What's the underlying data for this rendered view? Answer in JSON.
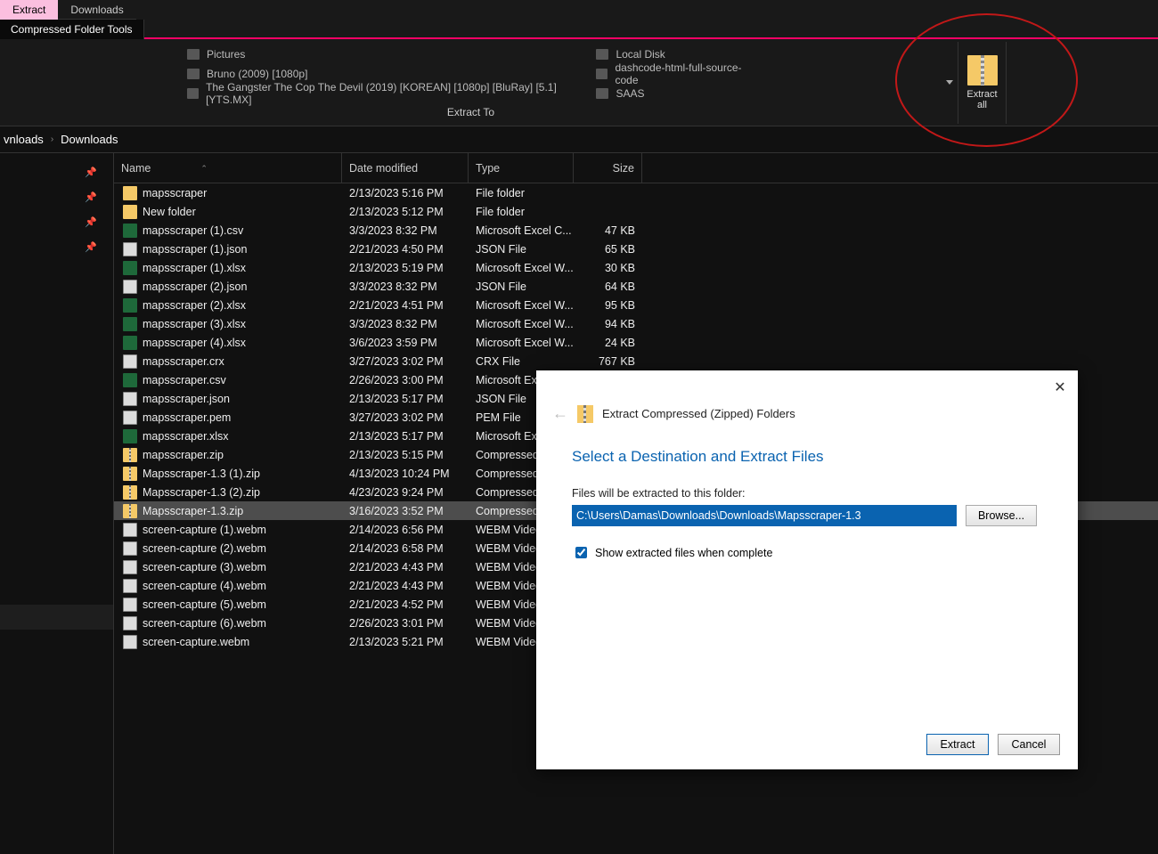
{
  "tabs": {
    "extract": "Extract",
    "downloads": "Downloads"
  },
  "toolbar": {
    "compressed": "Compressed Folder Tools"
  },
  "ribbon": {
    "left": [
      "Pictures",
      "Bruno (2009) [1080p]",
      "The Gangster The Cop The Devil (2019) [KOREAN] [1080p] [BluRay] [5.1] [YTS.MX]"
    ],
    "right": [
      "Local Disk",
      "dashcode-html-full-source-code",
      "SAAS"
    ],
    "extract_to": "Extract To",
    "extract_all1": "Extract",
    "extract_all2": "all"
  },
  "crumbs": {
    "a": "vnloads",
    "b": "Downloads"
  },
  "columns": {
    "name": "Name",
    "date": "Date modified",
    "type": "Type",
    "size": "Size"
  },
  "files": [
    {
      "icon": "ic-folder",
      "name": "mapsscraper",
      "date": "2/13/2023 5:16 PM",
      "type": "File folder",
      "size": ""
    },
    {
      "icon": "ic-folder",
      "name": "New folder",
      "date": "2/13/2023 5:12 PM",
      "type": "File folder",
      "size": ""
    },
    {
      "icon": "ic-csv",
      "name": "mapsscraper (1).csv",
      "date": "3/3/2023 8:32 PM",
      "type": "Microsoft Excel C...",
      "size": "47 KB"
    },
    {
      "icon": "ic-json",
      "name": "mapsscraper (1).json",
      "date": "2/21/2023 4:50 PM",
      "type": "JSON File",
      "size": "65 KB"
    },
    {
      "icon": "ic-xlsx",
      "name": "mapsscraper (1).xlsx",
      "date": "2/13/2023 5:19 PM",
      "type": "Microsoft Excel W...",
      "size": "30 KB"
    },
    {
      "icon": "ic-json",
      "name": "mapsscraper (2).json",
      "date": "3/3/2023 8:32 PM",
      "type": "JSON File",
      "size": "64 KB"
    },
    {
      "icon": "ic-xlsx",
      "name": "mapsscraper (2).xlsx",
      "date": "2/21/2023 4:51 PM",
      "type": "Microsoft Excel W...",
      "size": "95 KB"
    },
    {
      "icon": "ic-xlsx",
      "name": "mapsscraper (3).xlsx",
      "date": "3/3/2023 8:32 PM",
      "type": "Microsoft Excel W...",
      "size": "94 KB"
    },
    {
      "icon": "ic-xlsx",
      "name": "mapsscraper (4).xlsx",
      "date": "3/6/2023 3:59 PM",
      "type": "Microsoft Excel W...",
      "size": "24 KB"
    },
    {
      "icon": "ic-crx",
      "name": "mapsscraper.crx",
      "date": "3/27/2023 3:02 PM",
      "type": "CRX File",
      "size": "767 KB"
    },
    {
      "icon": "ic-csv",
      "name": "mapsscraper.csv",
      "date": "2/26/2023 3:00 PM",
      "type": "Microsoft Exc",
      "size": ""
    },
    {
      "icon": "ic-json",
      "name": "mapsscraper.json",
      "date": "2/13/2023 5:17 PM",
      "type": "JSON File",
      "size": ""
    },
    {
      "icon": "ic-pem",
      "name": "mapsscraper.pem",
      "date": "3/27/2023 3:02 PM",
      "type": "PEM File",
      "size": ""
    },
    {
      "icon": "ic-xlsx",
      "name": "mapsscraper.xlsx",
      "date": "2/13/2023 5:17 PM",
      "type": "Microsoft Exc",
      "size": ""
    },
    {
      "icon": "ic-zip",
      "name": "mapsscraper.zip",
      "date": "2/13/2023 5:15 PM",
      "type": "Compressed",
      "size": ""
    },
    {
      "icon": "ic-zip",
      "name": "Mapsscraper-1.3 (1).zip",
      "date": "4/13/2023 10:24 PM",
      "type": "Compressed",
      "size": ""
    },
    {
      "icon": "ic-zip",
      "name": "Mapsscraper-1.3 (2).zip",
      "date": "4/23/2023 9:24 PM",
      "type": "Compressed",
      "size": ""
    },
    {
      "icon": "ic-zip",
      "name": "Mapsscraper-1.3.zip",
      "date": "3/16/2023 3:52 PM",
      "type": "Compressed",
      "size": "",
      "selected": true
    },
    {
      "icon": "ic-webm",
      "name": "screen-capture (1).webm",
      "date": "2/14/2023 6:56 PM",
      "type": "WEBM Video",
      "size": ""
    },
    {
      "icon": "ic-webm",
      "name": "screen-capture (2).webm",
      "date": "2/14/2023 6:58 PM",
      "type": "WEBM Video",
      "size": ""
    },
    {
      "icon": "ic-webm",
      "name": "screen-capture (3).webm",
      "date": "2/21/2023 4:43 PM",
      "type": "WEBM Video",
      "size": ""
    },
    {
      "icon": "ic-webm",
      "name": "screen-capture (4).webm",
      "date": "2/21/2023 4:43 PM",
      "type": "WEBM Video",
      "size": ""
    },
    {
      "icon": "ic-webm",
      "name": "screen-capture (5).webm",
      "date": "2/21/2023 4:52 PM",
      "type": "WEBM Video",
      "size": ""
    },
    {
      "icon": "ic-webm",
      "name": "screen-capture (6).webm",
      "date": "2/26/2023 3:01 PM",
      "type": "WEBM Video",
      "size": ""
    },
    {
      "icon": "ic-webm",
      "name": "screen-capture.webm",
      "date": "2/13/2023 5:21 PM",
      "type": "WEBM Video",
      "size": ""
    }
  ],
  "wizard": {
    "title": "Extract Compressed (Zipped) Folders",
    "h1": "Select a Destination and Extract Files",
    "label": "Files will be extracted to this folder:",
    "path": "C:\\Users\\Damas\\Downloads\\Downloads\\Mapsscraper-1.3",
    "browse": "Browse...",
    "show": "Show extracted files when complete",
    "extract": "Extract",
    "cancel": "Cancel"
  }
}
